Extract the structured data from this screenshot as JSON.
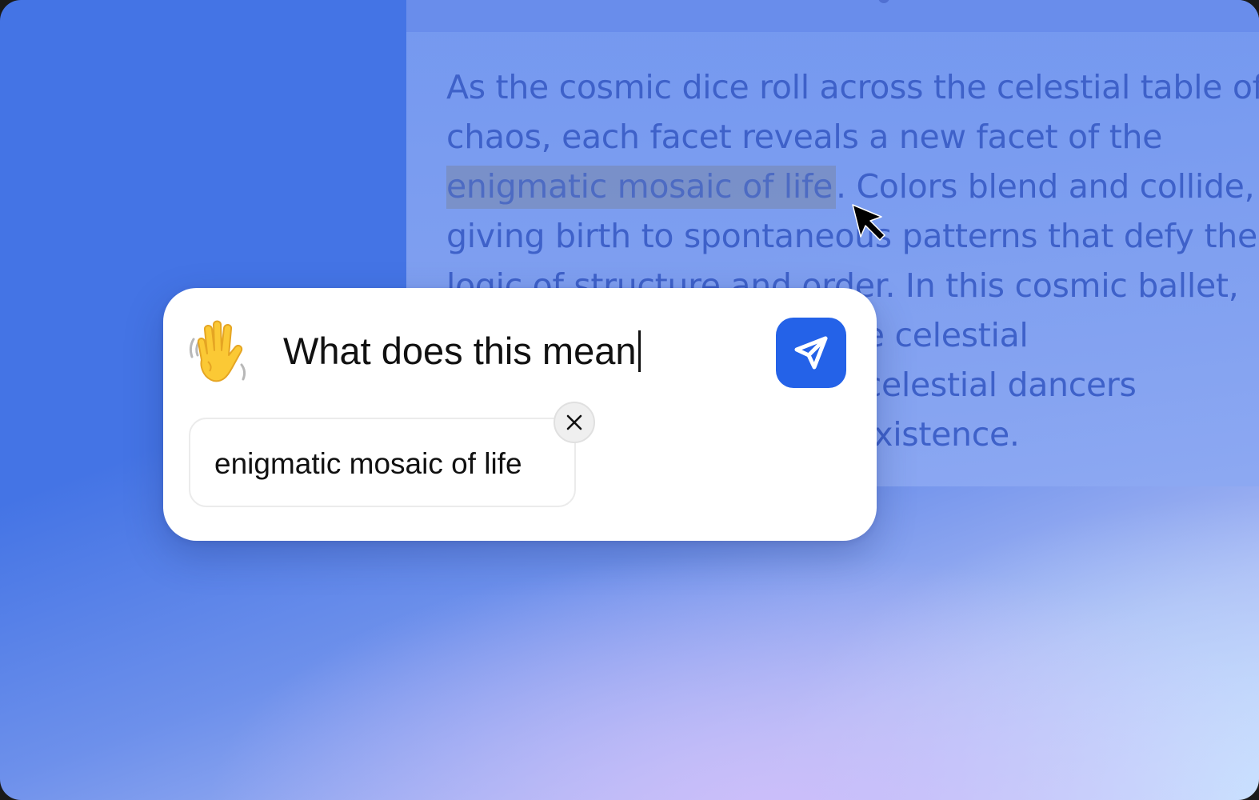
{
  "document": {
    "lines": [
      {
        "pre": "As the cosmic dice roll across the celestial table of",
        "hl": "",
        "post": ""
      },
      {
        "pre": "chaos, each facet reveals a new facet of the",
        "hl": "",
        "post": ""
      },
      {
        "pre": "",
        "hl": "enigmatic mosaic of life",
        "post": ". Colors blend and collide,"
      },
      {
        "pre": "giving birth to spontaneous patterns that defy the",
        "hl": "",
        "post": ""
      },
      {
        "pre": "logic of structure and order. In this cosmic ballet,",
        "hl": "",
        "post": ""
      },
      {
        "pre": "                                    ome celestial",
        "hl": "",
        "post": ""
      },
      {
        "pre": "                                    he celestial dancers",
        "hl": "",
        "post": ""
      },
      {
        "pre": "                                    of existence.",
        "hl": "",
        "post": ""
      }
    ]
  },
  "prompt_card": {
    "emoji": "waving-hand",
    "input_value": "What does this mean",
    "send_icon": "send-arrow-icon",
    "context_chip": {
      "label": "enigmatic mosaic of life",
      "close_icon": "close-icon"
    }
  },
  "colors": {
    "accent": "#2462e8",
    "background": "#4474e5",
    "doc_text": "#3e61c9"
  }
}
